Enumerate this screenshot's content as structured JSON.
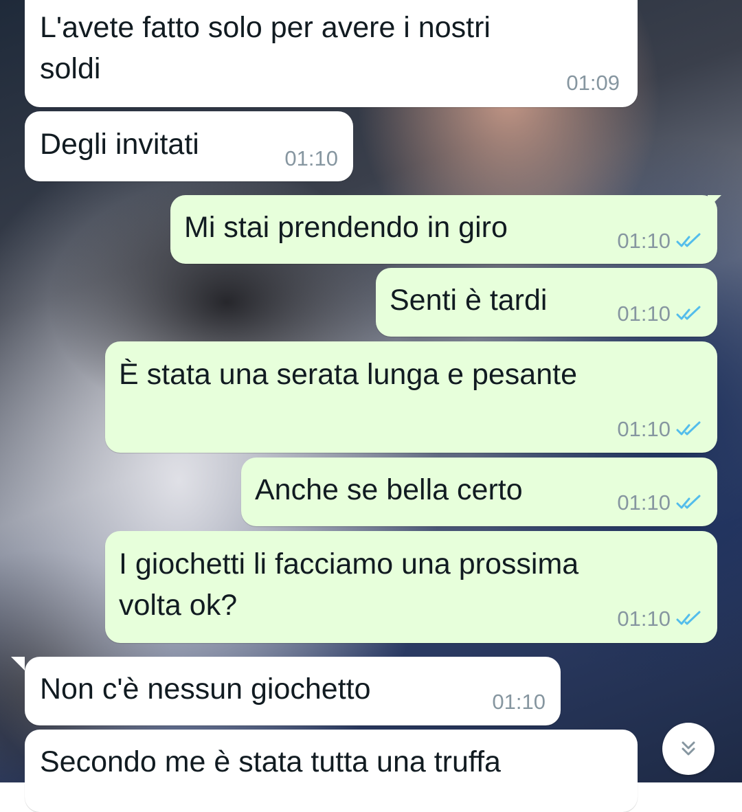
{
  "messages": [
    {
      "direction": "in",
      "text": "L'avete fatto solo per avere i nostri\nsoldi",
      "time": "01:09"
    },
    {
      "direction": "in",
      "text": "Degli invitati",
      "time": "01:10"
    },
    {
      "direction": "out",
      "text": "Mi stai prendendo in giro",
      "time": "01:10",
      "status": "read"
    },
    {
      "direction": "out",
      "text": "Senti è tardi",
      "time": "01:10",
      "status": "read"
    },
    {
      "direction": "out",
      "text": "È stata una serata lunga e pesante",
      "time": "01:10",
      "status": "read"
    },
    {
      "direction": "out",
      "text": "Anche se bella certo",
      "time": "01:10",
      "status": "read"
    },
    {
      "direction": "out",
      "text": "I giochetti li facciamo una prossima\nvolta ok?",
      "time": "01:10",
      "status": "read"
    },
    {
      "direction": "in",
      "text": "Non c'è nessun giochetto",
      "time": "01:10"
    },
    {
      "direction": "in",
      "text": "Secondo me è stata tutta una truffa",
      "time": ""
    }
  ],
  "colors": {
    "incoming_bubble": "#ffffff",
    "outgoing_bubble": "#e7ffdb",
    "read_ticks": "#53bdeb",
    "timestamp": "#8696a0"
  },
  "icons": {
    "read_receipt": "double-check-icon",
    "scroll_down": "chevron-double-down-icon"
  }
}
